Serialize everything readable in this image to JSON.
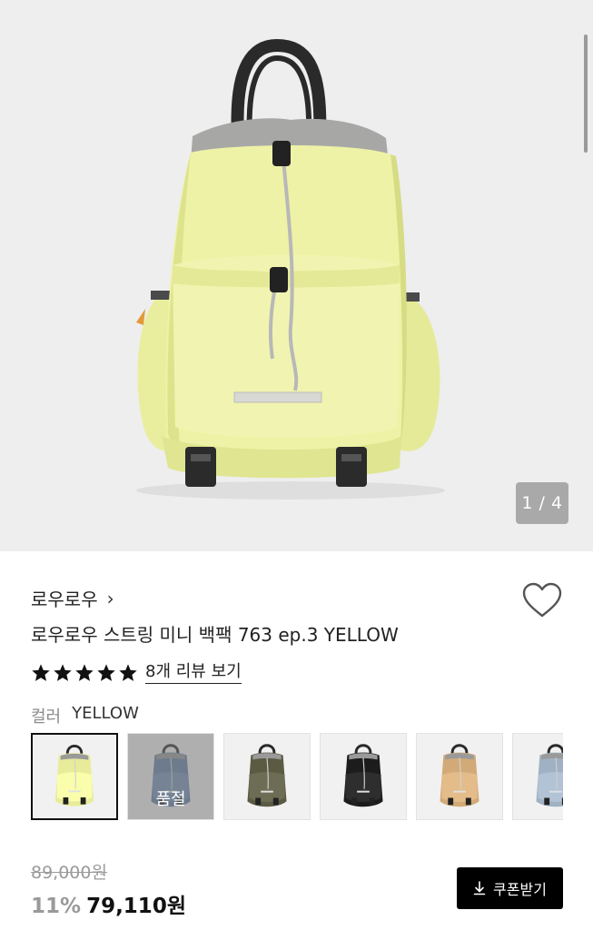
{
  "hero": {
    "pager": "1 / 4"
  },
  "product": {
    "brand": "로우로우",
    "brand_chevron": "›",
    "title": "로우로우 스트링 미니 백팩 763 ep.3 YELLOW",
    "rating_stars": 5,
    "review_link": "8개 리뷰 보기"
  },
  "color": {
    "label": "컬러",
    "selected": "YELLOW",
    "options": [
      {
        "color": "#e8ec9a",
        "selected": true,
        "sold_out": false
      },
      {
        "color": "#5f7fa6",
        "selected": false,
        "sold_out": true,
        "sold_out_label": "품절"
      },
      {
        "color": "#5b5a43",
        "selected": false,
        "sold_out": false
      },
      {
        "color": "#1c1c1c",
        "selected": false,
        "sold_out": false
      },
      {
        "color": "#d2aa78",
        "selected": false,
        "sold_out": false
      },
      {
        "color": "#9fb1c2",
        "selected": false,
        "sold_out": false
      }
    ]
  },
  "pricing": {
    "original": "89,000원",
    "discount": "11%",
    "final": "79,110원",
    "coupon_label": "쿠폰받기"
  },
  "icons": {
    "wishlist": "heart-outline-icon",
    "coupon": "download-icon",
    "star": "star-filled-icon"
  }
}
